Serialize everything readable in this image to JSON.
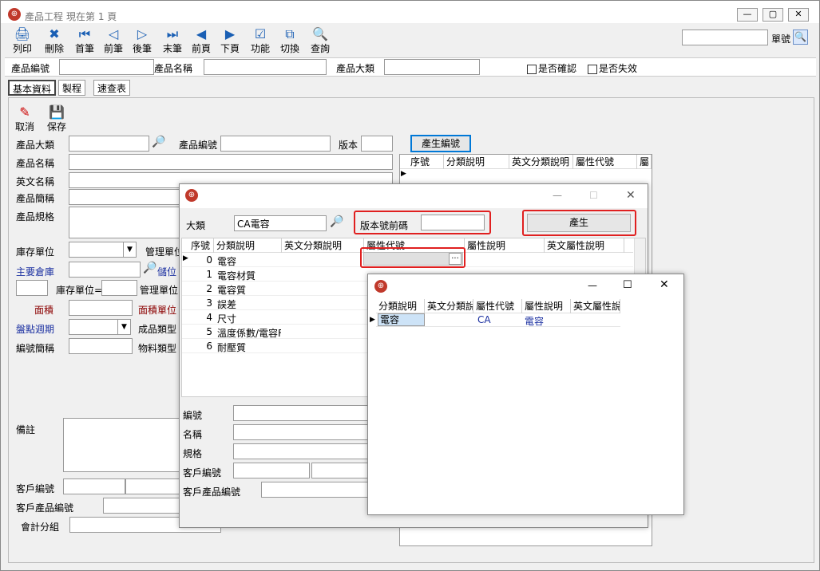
{
  "main_window": {
    "title": "產品工程",
    "subtitle": "現在第 1 頁",
    "controls": {
      "min": "—",
      "max": "▢",
      "close": "✕"
    }
  },
  "toolbar": {
    "buttons": [
      {
        "label": "列印",
        "icon": "🖨"
      },
      {
        "label": "刪除",
        "icon": "✖"
      },
      {
        "label": "首筆",
        "icon": "⏮"
      },
      {
        "label": "前筆",
        "icon": "◁"
      },
      {
        "label": "後筆",
        "icon": "▷"
      },
      {
        "label": "末筆",
        "icon": "⏭"
      },
      {
        "label": "前頁",
        "icon": "◀"
      },
      {
        "label": "下頁",
        "icon": "▶"
      },
      {
        "label": "功能",
        "icon": "☑"
      },
      {
        "label": "切換",
        "icon": "⧉"
      },
      {
        "label": "查詢",
        "icon": "🔍"
      }
    ],
    "doc_no_label": "單號",
    "doc_no_value": ""
  },
  "search_bar": {
    "product_no_label": "產品編號",
    "product_name_label": "產品名稱",
    "category_label": "產品大類",
    "confirmed_label": "是否確認",
    "invalid_label": "是否失效"
  },
  "tabs": [
    "基本資料",
    "製程",
    "速查表"
  ],
  "actions": {
    "cancel_label": "取消",
    "save_label": "保存"
  },
  "form": {
    "category": "產品大類",
    "product_no": "產品編號",
    "version": "版本",
    "generate_no": "產生編號",
    "name": "產品名稱",
    "en_name": "英文名稱",
    "short_name": "產品簡稱",
    "spec": "產品規格",
    "stock_unit": "庫存單位",
    "mgmt_unit": "管理單位",
    "main_warehouse": "主要倉庫",
    "storage": "儲位",
    "stock_unit_eq": "庫存單位=",
    "mgmt_unit2": "管理單位",
    "area": "面積",
    "area_unit": "面積單位",
    "count_cycle": "盤點週期",
    "finished_type": "成品類型",
    "code_short": "編號簡稱",
    "material_type": "物料類型",
    "note": "備註",
    "customer_no": "客戶編號",
    "customer_product_no": "客戶產品編號",
    "accounting_group": "會計分組"
  },
  "right_grid": {
    "headers": [
      "序號",
      "分類說明",
      "英文分類說明",
      "屬性代號",
      "屬"
    ]
  },
  "dialog1": {
    "category_label": "大類",
    "category_value": "CA電容",
    "version_prefix_label": "版本號前碼",
    "version_prefix_value": "",
    "generate_label": "產生",
    "headers": [
      "序號",
      "分類說明",
      "英文分類說明",
      "屬性代號",
      "屬性說明",
      "英文屬性說明"
    ],
    "rows": [
      {
        "no": "0",
        "desc": "電容"
      },
      {
        "no": "1",
        "desc": "電容材質"
      },
      {
        "no": "2",
        "desc": "電容質"
      },
      {
        "no": "3",
        "desc": "誤差"
      },
      {
        "no": "4",
        "desc": "尺寸"
      },
      {
        "no": "5",
        "desc": "溫度係數/電容F"
      },
      {
        "no": "6",
        "desc": "耐壓質"
      }
    ],
    "ellipsis": "···",
    "bottom": {
      "code": "編號",
      "name": "名稱",
      "spec": "規格",
      "customer_no": "客戶編號",
      "customer_product_no": "客戶產品編號"
    },
    "controls": {
      "min": "—",
      "max": "☐",
      "close": "✕"
    }
  },
  "dialog2": {
    "headers": [
      "分類說明",
      "英文分類說",
      "屬性代號",
      "屬性說明",
      "英文屬性說"
    ],
    "row": {
      "desc": "電容",
      "en_desc": "",
      "attr_code": "CA",
      "attr_desc": "電容",
      "en_attr_desc": ""
    },
    "controls": {
      "min": "—",
      "max": "☐",
      "close": "✕"
    }
  },
  "colors": {
    "accent": "#0078d7",
    "red": "#e02020",
    "label_blue": "#1a2fa0",
    "label_red": "#8b0000"
  }
}
